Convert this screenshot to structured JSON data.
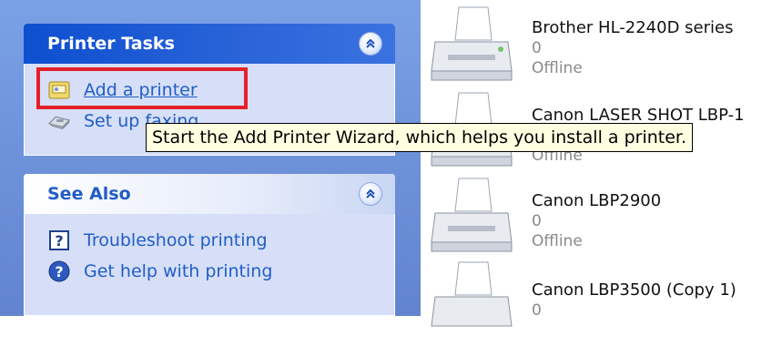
{
  "printer_tasks": {
    "title": "Printer Tasks",
    "items": [
      {
        "label": "Add a printer",
        "icon": "add-printer-icon"
      },
      {
        "label": "Set up faxing",
        "icon": "fax-icon"
      }
    ]
  },
  "see_also": {
    "title": "See Also",
    "items": [
      {
        "label": "Troubleshoot printing",
        "icon": "help-question-icon"
      },
      {
        "label": "Get help with printing",
        "icon": "help-circle-icon"
      }
    ]
  },
  "tooltip": "Start the Add Printer Wizard, which helps you install a printer.",
  "printers": [
    {
      "name": "Brother HL-2240D series",
      "docs": "0",
      "status": "Offline"
    },
    {
      "name": "Canon LASER SHOT LBP-1",
      "docs": "0",
      "status": "Offline"
    },
    {
      "name": "Canon LBP2900",
      "docs": "0",
      "status": "Offline"
    },
    {
      "name": "Canon LBP3500 (Copy 1)",
      "docs": "0",
      "status": ""
    }
  ],
  "colors": {
    "pane_blue": "#6f93db",
    "header_blue": "#0d4fd0",
    "link_blue": "#215dc6",
    "highlight_red": "#e4202a",
    "tooltip_bg": "#ffffe1"
  }
}
